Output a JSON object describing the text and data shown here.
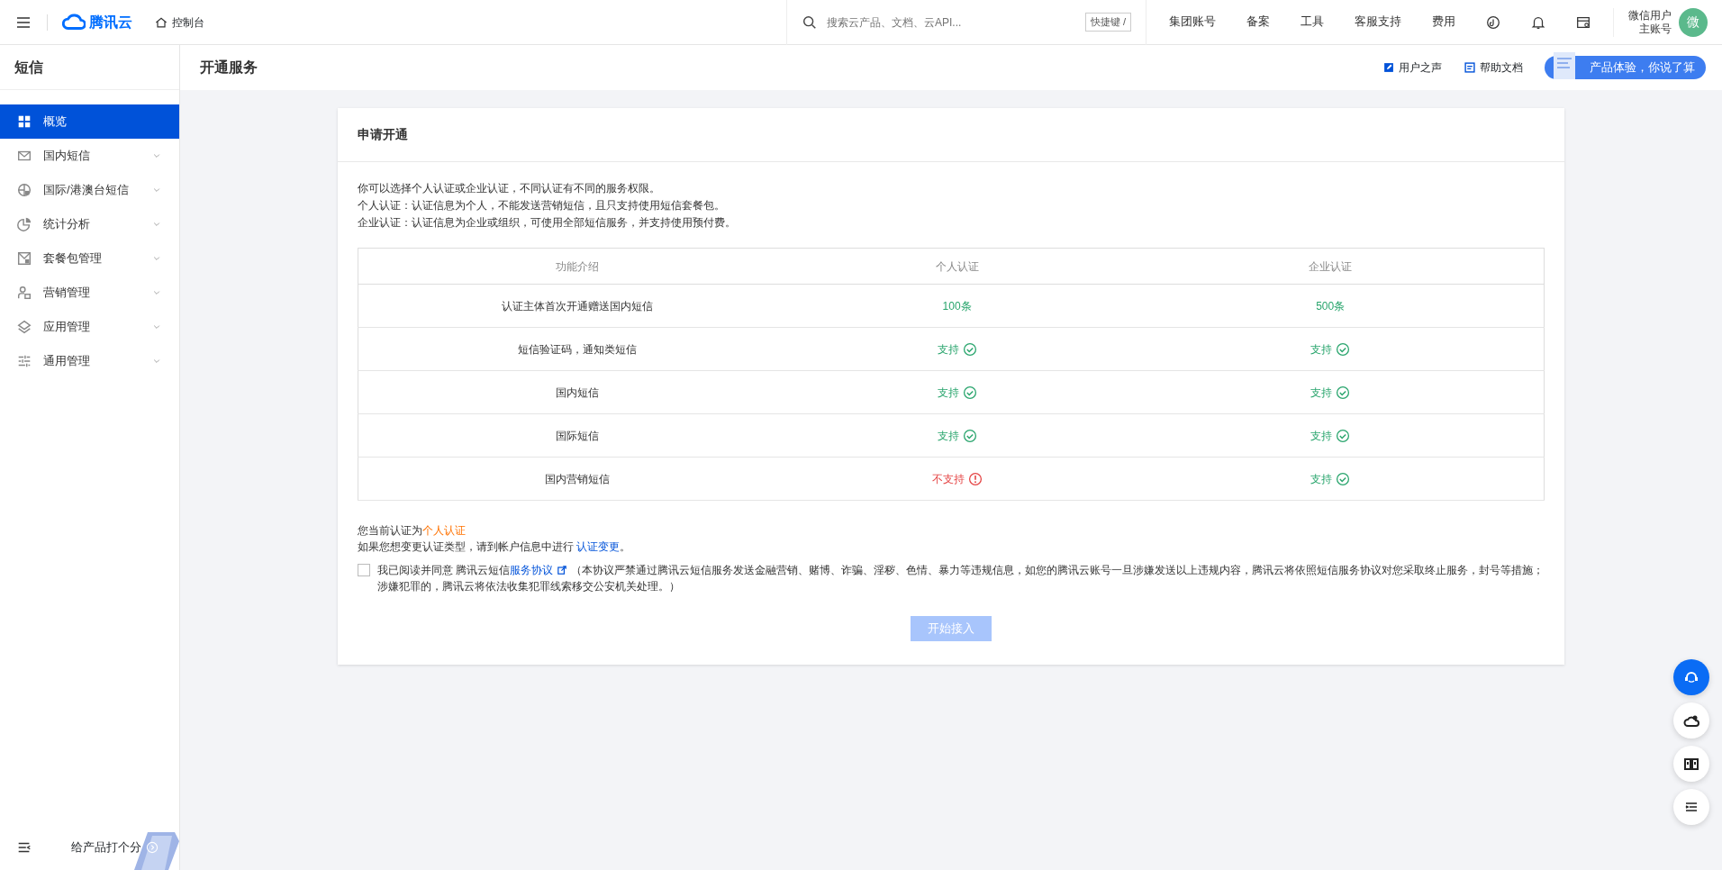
{
  "topbar": {
    "brand": "腾讯云",
    "console": "控制台",
    "search": {
      "placeholder": "搜索云产品、文档、云API..."
    },
    "shortcut": "快捷键 /",
    "nav": [
      "集团账号",
      "备案",
      "工具",
      "客服支持",
      "费用"
    ],
    "user": {
      "name": "微信用户",
      "role": "主账号",
      "avatar": "微"
    }
  },
  "sidebar": {
    "title": "短信",
    "items": [
      {
        "label": "概览",
        "selected": true,
        "expandable": false
      },
      {
        "label": "国内短信",
        "selected": false,
        "expandable": true
      },
      {
        "label": "国际/港澳台短信",
        "selected": false,
        "expandable": true
      },
      {
        "label": "统计分析",
        "selected": false,
        "expandable": true
      },
      {
        "label": "套餐包管理",
        "selected": false,
        "expandable": true
      },
      {
        "label": "营销管理",
        "selected": false,
        "expandable": true
      },
      {
        "label": "应用管理",
        "selected": false,
        "expandable": true
      },
      {
        "label": "通用管理",
        "selected": false,
        "expandable": true
      }
    ],
    "footer": "给产品打个分"
  },
  "page": {
    "title": "开通服务",
    "links": [
      "用户之声",
      "帮助文档"
    ],
    "promo": "产品体验，你说了算"
  },
  "card": {
    "title": "申请开通",
    "intro": [
      "你可以选择个人认证或企业认证，不同认证有不同的服务权限。",
      "个人认证：认证信息为个人，不能发送营销短信，且只支持使用短信套餐包。",
      "企业认证：认证信息为企业或组织，可使用全部短信服务，并支持使用预付费。"
    ],
    "table": {
      "columns": [
        "功能介绍",
        "个人认证",
        "企业认证"
      ],
      "rows": [
        {
          "cells": [
            {
              "text": "认证主体首次开通赠送国内短信",
              "kind": "feature"
            },
            {
              "text": "100条",
              "kind": "count"
            },
            {
              "text": "500条",
              "kind": "count"
            }
          ]
        },
        {
          "cells": [
            {
              "text": "短信验证码，通知类短信",
              "kind": "feature"
            },
            {
              "text": "支持",
              "kind": "supported"
            },
            {
              "text": "支持",
              "kind": "supported"
            }
          ]
        },
        {
          "cells": [
            {
              "text": "国内短信",
              "kind": "feature"
            },
            {
              "text": "支持",
              "kind": "supported"
            },
            {
              "text": "支持",
              "kind": "supported"
            }
          ]
        },
        {
          "cells": [
            {
              "text": "国际短信",
              "kind": "feature"
            },
            {
              "text": "支持",
              "kind": "supported"
            },
            {
              "text": "支持",
              "kind": "supported"
            }
          ]
        },
        {
          "cells": [
            {
              "text": "国内营销短信",
              "kind": "feature"
            },
            {
              "text": "不支持",
              "kind": "unsupported"
            },
            {
              "text": "支持",
              "kind": "supported"
            }
          ]
        }
      ]
    },
    "current": {
      "prefix": "您当前认证为",
      "value": "个人认证"
    },
    "change": {
      "text": "如果您想变更认证类型，请到帐户信息中进行 ",
      "link": "认证变更",
      "suffix": "。"
    },
    "agreement": {
      "checked": false,
      "prefix": "我已阅读并同意 腾讯云短信",
      "link": "服务协议",
      "note": "（本协议严禁通过腾讯云短信服务发送金融营销、赌博、诈骗、淫秽、色情、暴力等违规信息，如您的腾讯云账号一旦涉嫌发送以上违规内容，腾讯云将依照短信服务协议对您采取终止服务，封号等措施；涉嫌犯罪的，腾讯云将依法收集犯罪线索移交公安机关处理。）"
    },
    "submit": {
      "label": "开始接入",
      "disabled": true
    }
  }
}
